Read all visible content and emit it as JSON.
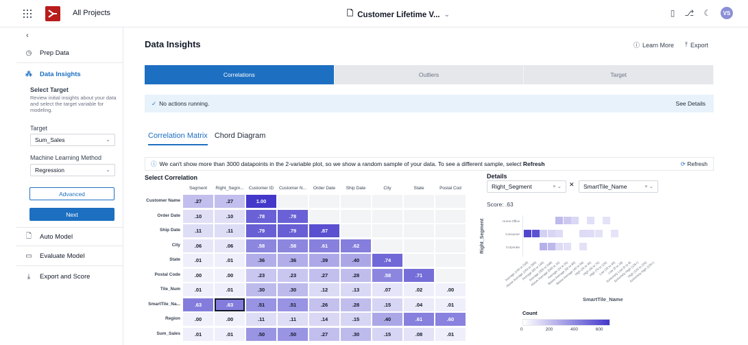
{
  "topbar": {
    "all_projects": "All Projects",
    "doc_title": "Customer Lifetime V...",
    "avatar": "VS"
  },
  "sidebar": {
    "items": [
      {
        "label": "Prep Data",
        "icon": "clock-icon"
      },
      {
        "label": "Data Insights",
        "icon": "insights-icon"
      },
      {
        "label": "Auto Model",
        "icon": "document-icon"
      },
      {
        "label": "Evaluate Model",
        "icon": "monitor-icon"
      },
      {
        "label": "Export and Score",
        "icon": "download-icon"
      }
    ],
    "select_target_title": "Select Target",
    "select_target_desc": "Review initial insights about your data and select the target variable for modeling.",
    "target_label": "Target",
    "target_value": "Sum_Sales",
    "ml_method_label": "Machine Learning Method",
    "ml_method_value": "Regression",
    "advanced_label": "Advanced",
    "next_label": "Next"
  },
  "main": {
    "title": "Data Insights",
    "learn_more": "Learn More",
    "export": "Export",
    "tabs": [
      "Correlations",
      "Outliers",
      "Target"
    ],
    "notice": "No actions running.",
    "see_details": "See Details",
    "subtabs": [
      "Correlation Matrix",
      "Chord Diagram"
    ],
    "info_text": "We can't show more than 3000 datapoints in the 2-variable plot, so we show a random sample of your data. To see a different sample, select",
    "info_link": "Refresh",
    "refresh_button": "Refresh",
    "select_correlation": "Select Correlation"
  },
  "matrix": {
    "columns": [
      "Segment",
      "Right_Segm...",
      "Customer ID",
      "Customer N...",
      "Order Date",
      "Ship Date",
      "City",
      "State",
      "Postal Cod"
    ],
    "rows": [
      {
        "label": "Customer Name",
        "values": [
          ".27",
          ".27",
          "1.00"
        ]
      },
      {
        "label": "Order Date",
        "values": [
          ".10",
          ".10",
          ".78",
          ".78"
        ]
      },
      {
        "label": "Ship Date",
        "values": [
          ".11",
          ".11",
          ".79",
          ".79",
          ".87"
        ]
      },
      {
        "label": "City",
        "values": [
          ".06",
          ".06",
          ".58",
          ".58",
          ".61",
          ".62"
        ]
      },
      {
        "label": "State",
        "values": [
          ".01",
          ".01",
          ".36",
          ".36",
          ".39",
          ".40",
          ".74"
        ]
      },
      {
        "label": "Postal Code",
        "values": [
          ".00",
          ".00",
          ".23",
          ".23",
          ".27",
          ".28",
          ".58",
          ".71"
        ]
      },
      {
        "label": "Tile_Num",
        "values": [
          ".01",
          ".01",
          ".30",
          ".30",
          ".12",
          ".13",
          ".07",
          ".02",
          ".00"
        ]
      },
      {
        "label": "SmartTile_Na...",
        "values": [
          ".63",
          ".63",
          ".51",
          ".51",
          ".26",
          ".28",
          ".15",
          ".04",
          ".01"
        ]
      },
      {
        "label": "Region",
        "values": [
          ".00",
          ".00",
          ".11",
          ".11",
          ".14",
          ".15",
          ".40",
          ".61",
          ".60"
        ]
      },
      {
        "label": "Sum_Sales",
        "values": [
          ".01",
          ".01",
          ".50",
          ".50",
          ".27",
          ".30",
          ".15",
          ".08",
          ".01"
        ]
      }
    ],
    "selected": {
      "row": 7,
      "col": 1
    }
  },
  "details": {
    "title": "Details",
    "var1": "Right_Segment",
    "var2": "SmartTile_Name",
    "score": "Score: .63",
    "y_label": "Right_Segment",
    "x_label": "SmartTile_Name",
    "heat_rows": [
      "Home Office",
      "Consumer",
      "Corporate"
    ],
    "heat_cols": [
      "Average (140 to 243)",
      "Above Average (243 to 350)",
      "Average (80 to 140)",
      "Average (350 to 548)",
      "Above Average (548 to 1k)",
      "Average (1k to 2k)",
      "Below Average (56 to 80)",
      "Below Average (40 to 56)",
      "High (2k to 4k)",
      "High (4k to 7k)",
      "High (7k to 12k)",
      "Low (18 to 40)",
      "Low (8 to 18)",
      "Extremely Low (0 to 8)",
      "Extremely High (12k+)",
      "High (12k to 22k)",
      "Extremely High (22k+)"
    ],
    "heat_cells": [
      {
        "row": 0,
        "col": 4,
        "count": 180
      },
      {
        "row": 0,
        "col": 5,
        "count": 120
      },
      {
        "row": 0,
        "col": 6,
        "count": 60
      },
      {
        "row": 0,
        "col": 8,
        "count": 30
      },
      {
        "row": 0,
        "col": 10,
        "count": 20
      },
      {
        "row": 1,
        "col": 0,
        "count": 640
      },
      {
        "row": 1,
        "col": 1,
        "count": 600
      },
      {
        "row": 1,
        "col": 2,
        "count": 90
      },
      {
        "row": 1,
        "col": 3,
        "count": 70
      },
      {
        "row": 1,
        "col": 4,
        "count": 40
      },
      {
        "row": 1,
        "col": 7,
        "count": 50
      },
      {
        "row": 1,
        "col": 8,
        "count": 45
      },
      {
        "row": 1,
        "col": 9,
        "count": 20
      },
      {
        "row": 1,
        "col": 11,
        "count": 15
      },
      {
        "row": 2,
        "col": 2,
        "count": 220
      },
      {
        "row": 2,
        "col": 3,
        "count": 190
      },
      {
        "row": 2,
        "col": 4,
        "count": 50
      },
      {
        "row": 2,
        "col": 5,
        "count": 30
      },
      {
        "row": 2,
        "col": 7,
        "count": 25
      }
    ],
    "count_label": "Count",
    "count_ticks": [
      "0",
      "200",
      "400",
      "600"
    ],
    "count_max": 700
  },
  "colors": {
    "accent": "#1d6fc1",
    "strong": "#4338ca",
    "light": "#ffffff"
  }
}
